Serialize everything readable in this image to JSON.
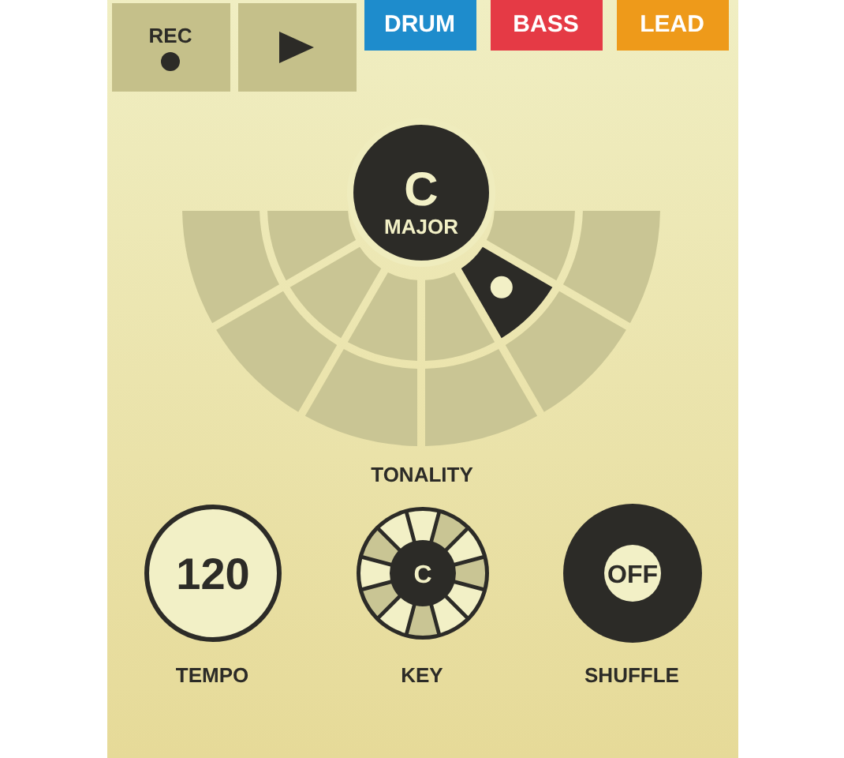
{
  "transport": [
    {
      "kind": "record",
      "label": "REC"
    },
    {
      "kind": "play"
    }
  ],
  "tracks": [
    {
      "label": "DRUM",
      "color": "#1e8ccc"
    },
    {
      "label": "BASS",
      "color": "#e53a45"
    },
    {
      "label": "LEAD",
      "color": "#ee9a1a"
    }
  ],
  "tonality": {
    "key": "C",
    "mode": "MAJOR",
    "label": "TONALITY",
    "outer_ring": [
      {
        "selected": false
      },
      {
        "selected": false
      },
      {
        "selected": false
      },
      {
        "selected": false
      },
      {
        "selected": false
      },
      {
        "selected": false
      }
    ],
    "inner_ring": [
      {
        "selected": false
      },
      {
        "selected": false
      },
      {
        "selected": false
      },
      {
        "selected": false
      },
      {
        "selected": true
      },
      {
        "selected": false
      }
    ]
  },
  "tempo": {
    "value": "120",
    "label": "TEMPO"
  },
  "key": {
    "value": "C",
    "label": "KEY",
    "segments": [
      {
        "filled": false
      },
      {
        "filled": true
      },
      {
        "filled": false
      },
      {
        "filled": true
      },
      {
        "filled": false
      },
      {
        "filled": false
      },
      {
        "filled": true
      },
      {
        "filled": false
      },
      {
        "filled": true
      },
      {
        "filled": false
      },
      {
        "filled": true
      },
      {
        "filled": false
      }
    ]
  },
  "shuffle": {
    "value": "OFF",
    "label": "SHUFFLE"
  }
}
